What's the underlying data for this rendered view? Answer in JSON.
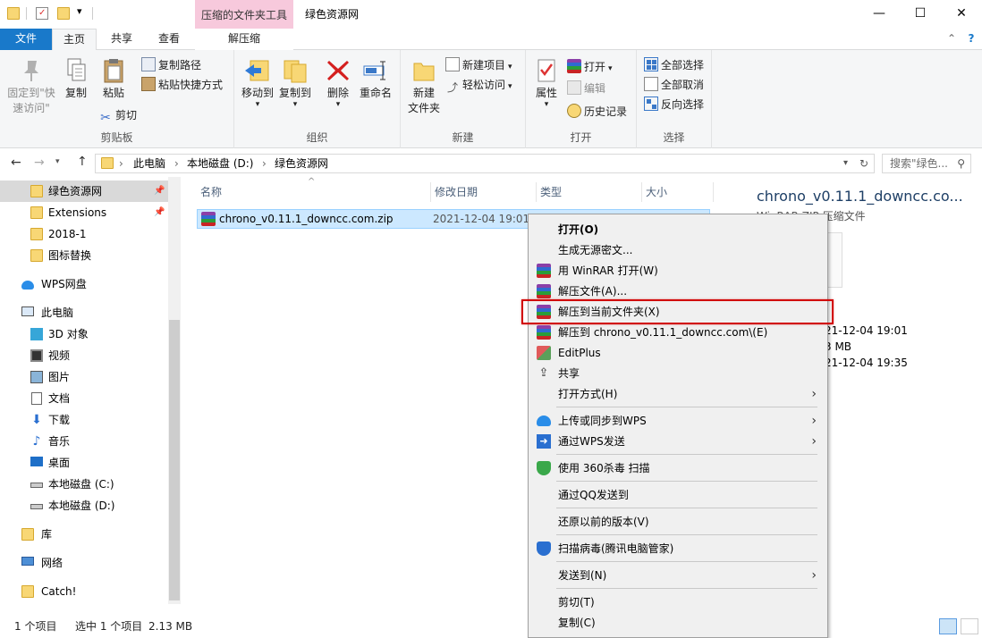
{
  "titlebar": {
    "context_tab_header": "压缩的文件夹工具",
    "window_title": "绿色资源网",
    "minimize": "—",
    "maximize": "☐",
    "close": "✕",
    "qat_dropdown": "▾"
  },
  "tabs": {
    "file": "文件",
    "home": "主页",
    "share": "共享",
    "view": "查看",
    "extract": "解压缩",
    "collapse": "⌃",
    "help": "?"
  },
  "ribbon": {
    "clipboard": {
      "label": "剪贴板",
      "pin_line1": "固定到\"快",
      "pin_line2": "速访问\"",
      "copy": "复制",
      "paste": "粘贴",
      "copy_path": "复制路径",
      "paste_shortcut": "粘贴快捷方式",
      "cut": "剪切"
    },
    "organize": {
      "label": "组织",
      "move_to": "移动到",
      "copy_to": "复制到",
      "delete": "删除",
      "rename": "重命名"
    },
    "new": {
      "label": "新建",
      "new_folder_line1": "新建",
      "new_folder_line2": "文件夹",
      "new_item": "新建项目",
      "easy_access": "轻松访问"
    },
    "open": {
      "label": "打开",
      "properties": "属性",
      "open": "打开",
      "edit": "编辑",
      "history": "历史记录"
    },
    "select": {
      "label": "选择",
      "select_all": "全部选择",
      "select_none": "全部取消",
      "invert": "反向选择"
    }
  },
  "address": {
    "crumbs": [
      "此电脑",
      "本地磁盘 (D:)",
      "绿色资源网"
    ],
    "search_placeholder": "搜索\"绿色..."
  },
  "nav": {
    "quick_access": [
      "绿色资源网",
      "Extensions",
      "2018-1",
      "图标替换"
    ],
    "wps": "WPS网盘",
    "this_pc": "此电脑",
    "pc_items": [
      "3D 对象",
      "视频",
      "图片",
      "文档",
      "下载",
      "音乐",
      "桌面",
      "本地磁盘 (C:)",
      "本地磁盘 (D:)"
    ],
    "library": "库",
    "network": "网络",
    "catch": "Catch!"
  },
  "filelist": {
    "columns": [
      "名称",
      "修改日期",
      "类型",
      "大小"
    ],
    "file": {
      "name": "chrono_v0.11.1_downcc.com.zip",
      "date": "2021-12-04 19:01"
    }
  },
  "details": {
    "title": "chrono_v0.11.1_downcc.co...",
    "type": "WinRAR ZIP 压缩文件",
    "modified": "21-12-04 19:01",
    "size": "3 MB",
    "created": "21-12-04 19:35"
  },
  "context_menu": {
    "open": "打开(O)",
    "gen_pwd": "生成无源密文...",
    "open_winrar": "用 WinRAR 打开(W)",
    "extract_files": "解压文件(A)...",
    "extract_here": "解压到当前文件夹(X)",
    "extract_to": "解压到 chrono_v0.11.1_downcc.com\\(E)",
    "editplus": "EditPlus",
    "share": "共享",
    "open_with": "打开方式(H)",
    "upload_wps": "上传或同步到WPS",
    "send_wps": "通过WPS发送",
    "scan_360": "使用 360杀毒 扫描",
    "send_qq": "通过QQ发送到",
    "restore": "还原以前的版本(V)",
    "scan_tencent": "扫描病毒(腾讯电脑管家)",
    "send_to": "发送到(N)",
    "cut": "剪切(T)",
    "copy": "复制(C)",
    "arrow": "›"
  },
  "status": {
    "count": "1 个项目",
    "selected": "选中 1 个项目",
    "size": "2.13 MB"
  }
}
